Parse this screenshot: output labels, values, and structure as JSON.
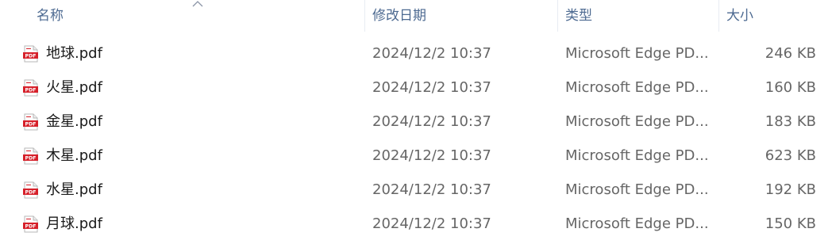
{
  "columns": {
    "name": "名称",
    "modified": "修改日期",
    "type": "类型",
    "size": "大小"
  },
  "sort": {
    "column": "name",
    "direction": "ascending",
    "icon": "sort-up-chevron-icon"
  },
  "file_icon": {
    "name": "pdf-file-icon",
    "label": "PDF",
    "color": "#d6202a"
  },
  "files": [
    {
      "name": "地球.pdf",
      "modified": "2024/12/2 10:37",
      "type": "Microsoft Edge PD...",
      "size": "246 KB"
    },
    {
      "name": "火星.pdf",
      "modified": "2024/12/2 10:37",
      "type": "Microsoft Edge PD...",
      "size": "160 KB"
    },
    {
      "name": "金星.pdf",
      "modified": "2024/12/2 10:37",
      "type": "Microsoft Edge PD...",
      "size": "183 KB"
    },
    {
      "name": "木星.pdf",
      "modified": "2024/12/2 10:37",
      "type": "Microsoft Edge PD...",
      "size": "623 KB"
    },
    {
      "name": "水星.pdf",
      "modified": "2024/12/2 10:37",
      "type": "Microsoft Edge PD...",
      "size": "192 KB"
    },
    {
      "name": "月球.pdf",
      "modified": "2024/12/2 10:37",
      "type": "Microsoft Edge PD...",
      "size": "150 KB"
    }
  ]
}
